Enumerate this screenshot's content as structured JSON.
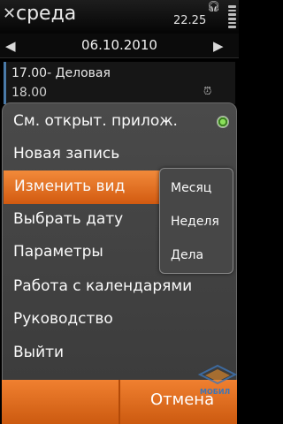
{
  "statusbar": {
    "title": "среда",
    "time": "22.25"
  },
  "datebar": {
    "date": "06.10.2010"
  },
  "event": {
    "start": "17.00- Деловая",
    "end": "18.00"
  },
  "menu": {
    "items": [
      {
        "label": "См. открыт. прилож."
      },
      {
        "label": "Новая запись"
      },
      {
        "label": "Изменить вид"
      },
      {
        "label": "Выбрать дату"
      },
      {
        "label": "Параметры"
      },
      {
        "label": "Работа с календарями"
      },
      {
        "label": "Руководство"
      },
      {
        "label": "Выйти"
      }
    ]
  },
  "submenu": {
    "items": [
      {
        "label": "Месяц"
      },
      {
        "label": "Неделя"
      },
      {
        "label": "Дела"
      }
    ]
  },
  "softkeys": {
    "cancel": "Отмена"
  },
  "watermark": {
    "text": "МОБИЛ"
  },
  "colors": {
    "accent": "#e8721f",
    "menu_bg": "#404040",
    "radio_on": "#6cc43a"
  }
}
